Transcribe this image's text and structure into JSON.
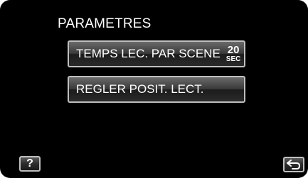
{
  "header": {
    "title": "PARAMETRES"
  },
  "menu": {
    "items": [
      {
        "label": "TEMPS LEC. PAR SCENE",
        "value": "20",
        "unit": "SEC"
      },
      {
        "label": "REGLER POSIT. LECT."
      }
    ]
  },
  "footer": {
    "help_label": "?",
    "back_icon": "return-arrow-icon"
  },
  "colors": {
    "background": "#000000",
    "button_border": "#bfbfbf",
    "text": "#ffffff"
  }
}
